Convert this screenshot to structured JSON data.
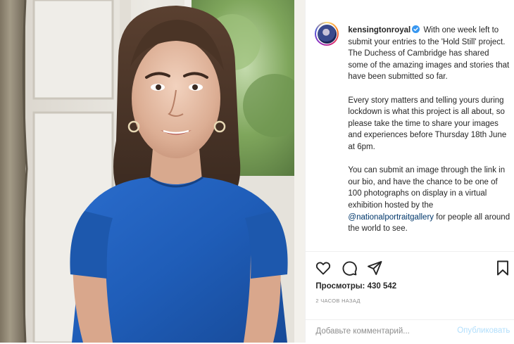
{
  "post": {
    "username": "kensingtonroyal",
    "caption_paragraphs": [
      "With one week left to submit your entries to the 'Hold Still' project. The Duchess of Cambridge has shared some of the amazing images and stories that have been submitted so far.",
      "Every story matters and telling yours during lockdown is what this project is all about, so please take the time to share your images and experiences before Thursday 18th June at 6pm."
    ],
    "caption_last_before": "You can submit an image through the link in our bio, and have the chance to be one of 100 photographs on display in a virtual exhibition hosted by the",
    "mention": "@nationalportraitgallery",
    "caption_last_after": "for people all around the world to see.",
    "views_label": "Просмотры:",
    "views_count": "430 542",
    "time_ago": "2 часов назад"
  },
  "comment": {
    "placeholder": "Добавьте комментарий...",
    "publish_label": "Опубликовать"
  },
  "icons": [
    "heart-icon",
    "comment-icon",
    "share-icon",
    "bookmark-icon",
    "verified-icon"
  ],
  "colors": {
    "link": "#00376b",
    "verified": "#3897f0",
    "publish_disabled": "#b2dffc",
    "secondary_text": "#8e8e8e",
    "dress_blue": "#1f5db8"
  }
}
